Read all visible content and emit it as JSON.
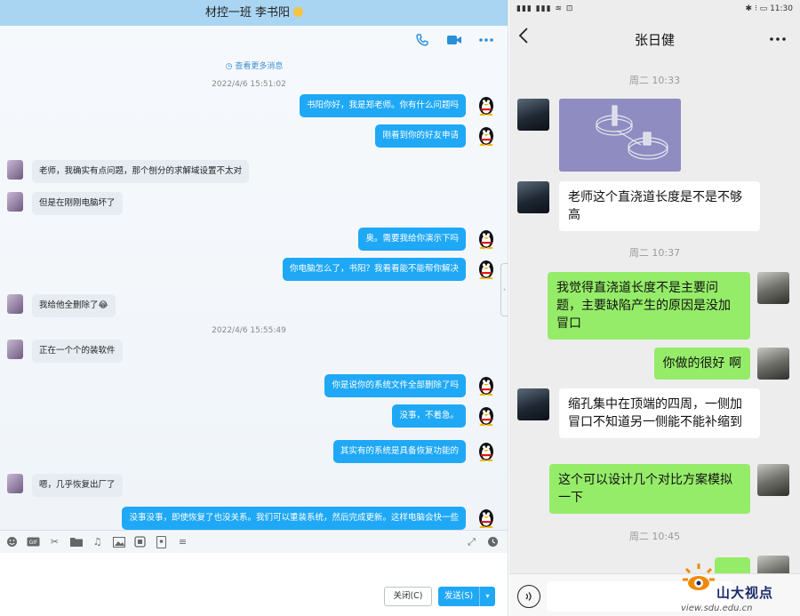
{
  "qq": {
    "title": "材控一班 李书阳",
    "more_messages": "查看更多消息",
    "messages": [
      {
        "type": "time",
        "text": "2022/4/6 15:51:02"
      },
      {
        "type": "me",
        "text": "书阳你好，我是郑老师。你有什么问题吗"
      },
      {
        "type": "me",
        "text": "刚看到你的好友申请"
      },
      {
        "type": "other",
        "text": "老师，我确实有点问题，那个刨分的求解域设置不太对"
      },
      {
        "type": "other",
        "text": "但是在刚刚电脑坏了"
      },
      {
        "type": "me",
        "text": "奥。需要我给你演示下吗"
      },
      {
        "type": "me",
        "text": "你电脑怎么了，书阳？我看看能不能帮你解决"
      },
      {
        "type": "other",
        "text": "我给他全删除了😂"
      },
      {
        "type": "time",
        "text": "2022/4/6 15:55:49"
      },
      {
        "type": "other",
        "text": "正在一个个的装软件"
      },
      {
        "type": "me",
        "text": "你是说你的系统文件全部删除了吗"
      },
      {
        "type": "me",
        "text": "没事，不着急。"
      },
      {
        "type": "me",
        "text": "其实有的系统是具备恢复功能的"
      },
      {
        "type": "other",
        "text": "嗯，几乎恢复出厂了"
      },
      {
        "type": "me",
        "text": "没事没事，即使恢复了也没关系。我们可以重装系统，然后完成更新。这样电脑会快一些"
      }
    ],
    "close_label": "关闭(C)",
    "send_label": "发送(S)"
  },
  "wechat": {
    "status_time": "11:30",
    "status_left": "▮▮▮ ▮▮▮ ≋ ⊡",
    "status_right_icons": "✱ ⁝ ▭",
    "contact_name": "张日健",
    "blocks": [
      {
        "type": "time",
        "text": "周二 10:33"
      },
      {
        "type": "image"
      },
      {
        "type": "other",
        "text": "老师这个直浇道长度是不是不够高"
      },
      {
        "type": "time",
        "text": "周二 10:37"
      },
      {
        "type": "me",
        "text": "我觉得直浇道长度不是主要问题，主要缺陷产生的原因是没加冒口"
      },
      {
        "type": "me",
        "text": "你做的很好 啊"
      },
      {
        "type": "other",
        "text": "缩孔集中在顶端的四周，一侧加冒口不知道另一侧能不能补缩到"
      },
      {
        "type": "me",
        "text": "这个可以设计几个对比方案模拟一下"
      },
      {
        "type": "time",
        "text": "周二 10:45"
      }
    ],
    "watermark_text": "山大视点",
    "watermark_url": "view.sdu.edu.cn"
  },
  "colors": {
    "qq_me_bubble": "#1fa8f5",
    "qq_other_bubble": "#e7ecf2",
    "wx_me_bubble": "#95ec69",
    "wx_other_bubble": "#ffffff"
  }
}
